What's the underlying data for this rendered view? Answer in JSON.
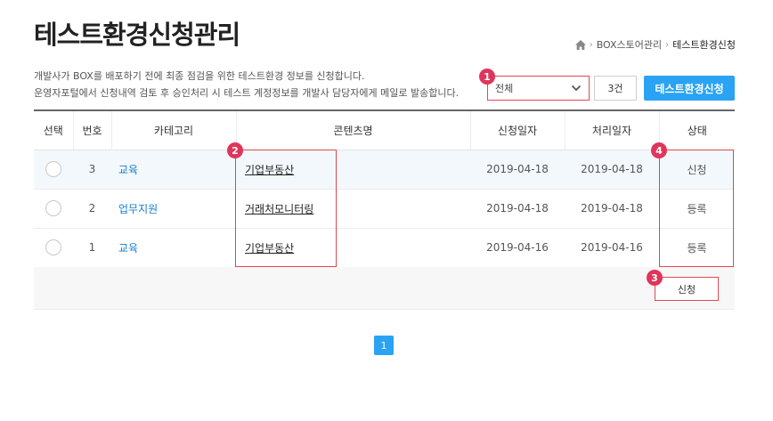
{
  "page": {
    "title": "테스트환경신청관리"
  },
  "breadcrumb": {
    "icon": "home-icon",
    "items": [
      "BOX스토어관리",
      "테스트환경신청"
    ]
  },
  "description": {
    "line1": "개발사가 BOX를 배포하기 전에 최종 점검을 위한 테스트환경 정보를 신청합니다.",
    "line2": "운영자포털에서 신청내역 검토 후 승인처리 시 테스트 계정정보를 개발사 담당자에게 메일로 발송합니다."
  },
  "filter": {
    "selected": "전체",
    "count": "3건",
    "apply_label": "테스트환경신청"
  },
  "markers": [
    "1",
    "2",
    "3",
    "4"
  ],
  "table": {
    "headers": [
      "선택",
      "번호",
      "카테고리",
      "콘텐츠명",
      "신청일자",
      "처리일자",
      "상태"
    ],
    "rows": [
      {
        "no": "3",
        "category": "교육",
        "content": "기업부동산",
        "requested": "2019-04-18",
        "processed": "2019-04-18",
        "status": "신청"
      },
      {
        "no": "2",
        "category": "업무지원",
        "content": "거래처모니터링",
        "requested": "2019-04-18",
        "processed": "2019-04-18",
        "status": "등록"
      },
      {
        "no": "1",
        "category": "교육",
        "content": "기업부동산",
        "requested": "2019-04-16",
        "processed": "2019-04-16",
        "status": "등록"
      }
    ]
  },
  "actions": {
    "request_label": "신청"
  },
  "pagination": {
    "current": "1"
  },
  "colors": {
    "accent": "#2aa3f2",
    "highlight": "#e04850",
    "marker": "#e0355a",
    "link": "#1a7fc9"
  }
}
